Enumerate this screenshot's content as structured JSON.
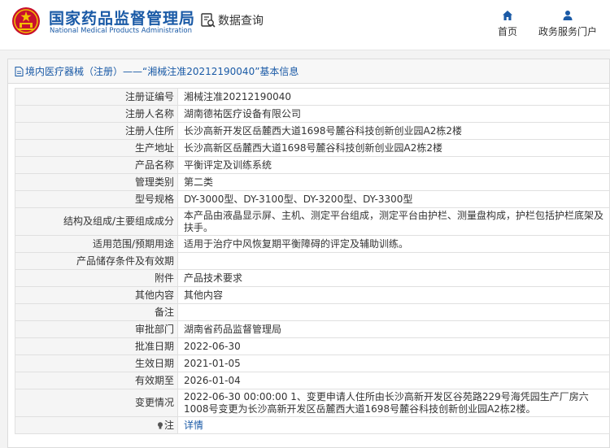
{
  "header": {
    "logo_cn": "国家药品监督管理局",
    "logo_en": "National Medical Products Administration",
    "query_label": "数据查询",
    "nav": {
      "home": "首页",
      "gov_portal": "政务服务门户"
    }
  },
  "panel": {
    "title": "境内医疗器械（注册）——“湘械注准20212190040”基本信息"
  },
  "rows": [
    {
      "label": "注册证编号",
      "value": "湘械注准20212190040"
    },
    {
      "label": "注册人名称",
      "value": "湖南德祐医疗设备有限公司"
    },
    {
      "label": "注册人住所",
      "value": "长沙高新开发区岳麓西大道1698号麓谷科技创新创业园A2栋2楼"
    },
    {
      "label": "生产地址",
      "value": "长沙高新区岳麓西大道1698号麓谷科技创新创业园A2栋2楼"
    },
    {
      "label": "产品名称",
      "value": "平衡评定及训练系统"
    },
    {
      "label": "管理类别",
      "value": "第二类"
    },
    {
      "label": "型号规格",
      "value": "DY-3000型、DY-3100型、DY-3200型、DY-3300型"
    },
    {
      "label": "结构及组成/主要组成成分",
      "value": "本产品由液晶显示屏、主机、测定平台组成，测定平台由护栏、测量盘构成，护栏包括护栏底架及扶手。"
    },
    {
      "label": "适用范围/预期用途",
      "value": "适用于治疗中风恢复期平衡障碍的评定及辅助训练。"
    },
    {
      "label": "产品储存条件及有效期",
      "value": ""
    },
    {
      "label": "附件",
      "value": "产品技术要求"
    },
    {
      "label": "其他内容",
      "value": "其他内容"
    },
    {
      "label": "备注",
      "value": ""
    },
    {
      "label": "审批部门",
      "value": "湖南省药品监督管理局"
    },
    {
      "label": "批准日期",
      "value": "2022-06-30"
    },
    {
      "label": "生效日期",
      "value": "2021-01-05"
    },
    {
      "label": "有效期至",
      "value": "2026-01-04"
    },
    {
      "label": "变更情况",
      "value": "2022-06-30 00:00:00 1、变更申请人住所由长沙高新开发区谷苑路229号海凭园生产厂房六1008号变更为长沙高新开发区岳麓西大道1698号麓谷科技创新创业园A2栋2楼。"
    }
  ],
  "note": {
    "label": "注",
    "link": "详情"
  },
  "colors": {
    "brand_blue": "#1a5aa6",
    "label_bg": "#f5f5f5",
    "border": "#e0e0e0"
  }
}
